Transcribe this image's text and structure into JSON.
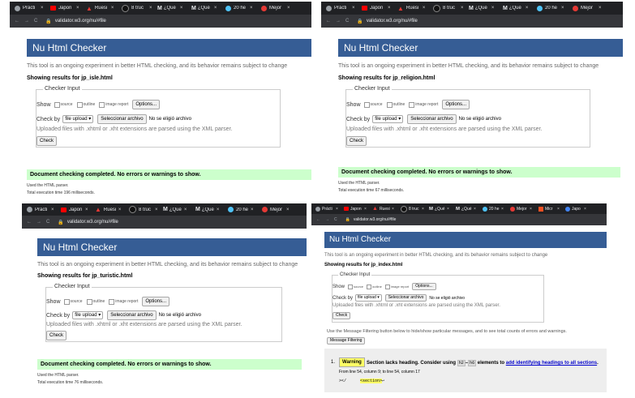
{
  "colors": {
    "tabbar": "#202124",
    "addressbar": "#35363a",
    "header": "#365d95",
    "success": "#ccffcc",
    "warning": "#ffff66"
  },
  "tabs": [
    {
      "label": "Prácti",
      "icon": "chrome-icon"
    },
    {
      "label": "Japon",
      "icon": "youtube-icon"
    },
    {
      "label": "Ruesi",
      "icon": "ruesi-icon"
    },
    {
      "label": "8 truc",
      "icon": "github-icon"
    },
    {
      "label": "¿Qué",
      "icon": "m-icon"
    },
    {
      "label": "¿Qué",
      "icon": "m-icon"
    },
    {
      "label": "20 he",
      "icon": "globe-icon"
    },
    {
      "label": "Mejor",
      "icon": "red-circle-icon"
    },
    {
      "label": "Micr",
      "icon": "microsoft-icon"
    },
    {
      "label": "Japo",
      "icon": "blue-icon"
    }
  ],
  "url": "validator.w3.org/nu/#file",
  "header_title": "Nu Html Checker",
  "intro": "This tool is an ongoing experiment in better HTML checking, and its behavior remains subject to change",
  "checker": {
    "legend": "Checker Input",
    "show_label": "Show",
    "opt_source": "source",
    "opt_outline": "outline",
    "opt_image": "image report",
    "options_btn": "Options...",
    "checkby_label": "Check by",
    "select_value": "file upload",
    "file_btn": "Seleccionar archivo",
    "no_file": "No se eligió archivo",
    "note": "Uploaded files with .xhtml or .xht extensions are parsed using the XML parser.",
    "check_btn": "Check"
  },
  "success_msg": "Document checking completed. No errors or warnings to show.",
  "parser_note": "Used the HTML parser.",
  "shots": [
    {
      "showing": "Showing results for jp_isle.html",
      "time": "Total execution time 196 milliseconds."
    },
    {
      "showing": "Showing results for jp_religion.html",
      "time": "Total execution time 67 milliseconds."
    },
    {
      "showing": "Showing results for jp_turistic.html",
      "time": "Total execution time 76 milliseconds."
    },
    {
      "showing": "Showing results for jp_index.html"
    }
  ],
  "filter": {
    "text": "Use the Message Filtering button below to hide/show particular messages, and to see total counts of errors and warnings.",
    "button": "Message Filtering"
  },
  "warning": {
    "num": "1.",
    "badge": "Warning",
    "text_before": "Section lacks heading. Consider using",
    "code1": "h2",
    "dash": "–",
    "code2": "h6",
    "text_mid": "elements to",
    "link": "add identifying headings to all sections",
    "period": ".",
    "location": "From line 54, column 9; to line 54, column 17",
    "ctx_left": "></",
    "ctx_code": "<section>",
    "ctx_right": "↩"
  }
}
